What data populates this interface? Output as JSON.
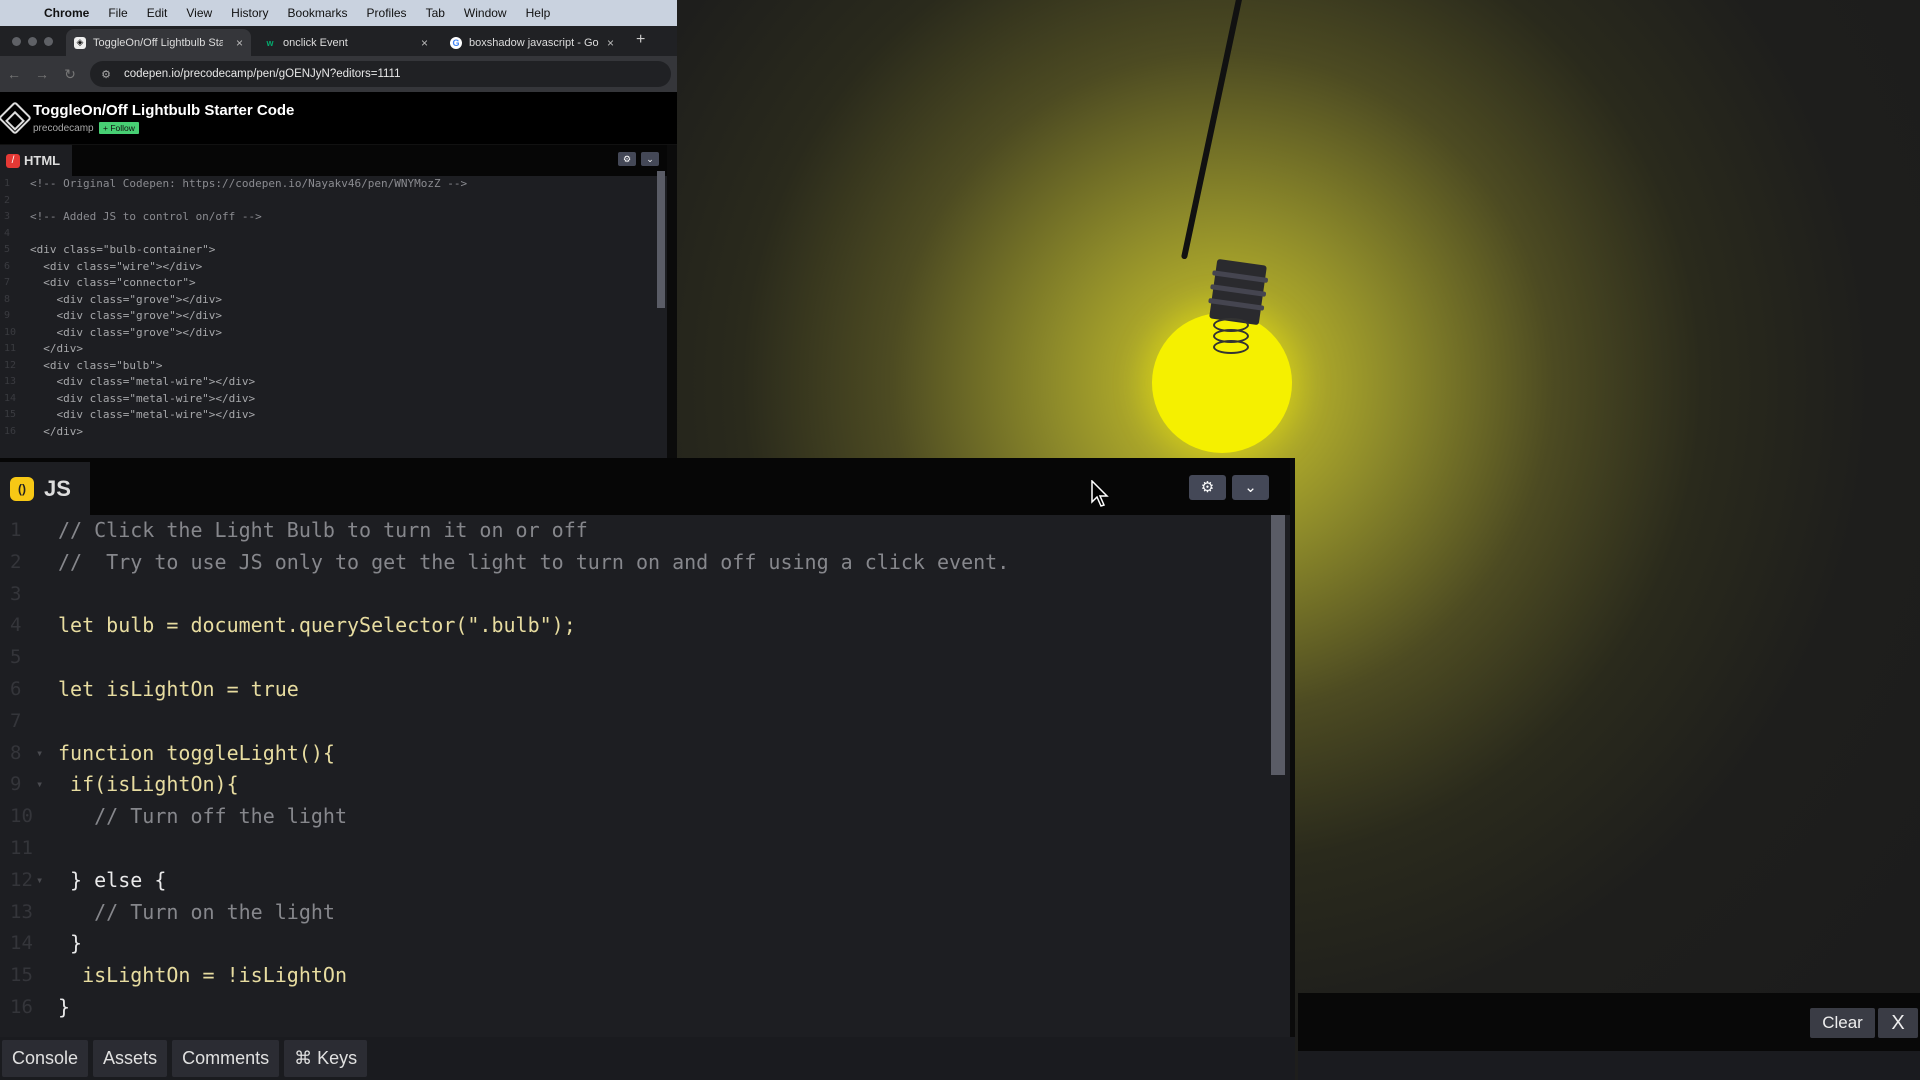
{
  "menubar": {
    "app": "Chrome",
    "items": [
      "File",
      "Edit",
      "View",
      "History",
      "Bookmarks",
      "Profiles",
      "Tab",
      "Window",
      "Help"
    ]
  },
  "browser": {
    "tabs": [
      {
        "title": "ToggleOn/Off Lightbulb Start",
        "icon": "codepen-icon",
        "active": true
      },
      {
        "title": "onclick Event",
        "icon": "w3schools-icon",
        "active": false
      },
      {
        "title": "boxshadow javascript - Goog",
        "icon": "google-icon",
        "active": false
      }
    ],
    "new_tab": "+",
    "close_glyph": "×",
    "url": "codepen.io/precodecamp/pen/gOENJyN?editors=1111"
  },
  "pen": {
    "title": "ToggleOn/Off Lightbulb Starter Code",
    "author": "precodecamp",
    "follow_label": "+ Follow"
  },
  "html_editor": {
    "label": "HTML",
    "lines": [
      "<!-- Original Codepen: https://codepen.io/Nayakv46/pen/WNYMozZ -->",
      "",
      "<!-- Added JS to control on/off -->",
      "",
      "<div class=\"bulb-container\">",
      "  <div class=\"wire\"></div>",
      "  <div class=\"connector\">",
      "    <div class=\"grove\"></div>",
      "    <div class=\"grove\"></div>",
      "    <div class=\"grove\"></div>",
      "  </div>",
      "  <div class=\"bulb\">",
      "    <div class=\"metal-wire\"></div>",
      "    <div class=\"metal-wire\"></div>",
      "    <div class=\"metal-wire\"></div>",
      "  </div>"
    ]
  },
  "js_editor": {
    "label": "JS",
    "lines": [
      "// Click the Light Bulb to turn it on or off",
      "//  Try to use JS only to get the light to turn on and off using a click event.",
      "",
      "let bulb = document.querySelector(\".bulb\");",
      "",
      "let isLightOn = true",
      "",
      "function toggleLight(){",
      " if(isLightOn){",
      "   // Turn off the light",
      "",
      " } else {",
      "   // Turn on the light",
      " }",
      "  isLightOn = !isLightOn",
      "}"
    ]
  },
  "bottom_tabs": [
    "Console",
    "Assets",
    "Comments",
    "⌘ Keys"
  ],
  "console": {
    "clear_label": "Clear",
    "close_label": "X"
  },
  "colors": {
    "bulb_on": "#f5f000",
    "codepen_green": "#47cf73",
    "html_badge": "#e53935",
    "js_badge": "#f7c815",
    "editor_bg": "#1d1e22"
  }
}
